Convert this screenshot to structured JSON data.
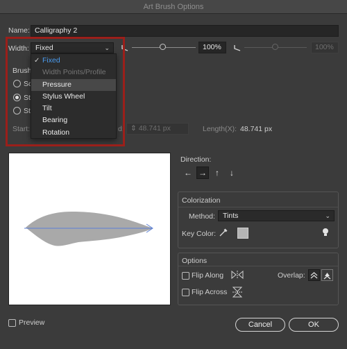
{
  "window": {
    "title": "Art Brush Options"
  },
  "name": {
    "label": "Name:",
    "value": "Calligraphy 2"
  },
  "width": {
    "label": "Width:",
    "selected": "Fixed",
    "percent": "100%",
    "percent_dim": "100%",
    "options": [
      {
        "label": "Fixed",
        "checked": true,
        "disabled": false
      },
      {
        "label": "Width Points/Profile",
        "checked": false,
        "disabled": true
      },
      {
        "label": "Pressure",
        "checked": false,
        "disabled": false,
        "hover": true
      },
      {
        "label": "Stylus Wheel",
        "checked": false,
        "disabled": false
      },
      {
        "label": "Tilt",
        "checked": false,
        "disabled": false
      },
      {
        "label": "Bearing",
        "checked": false,
        "disabled": false
      },
      {
        "label": "Rotation",
        "checked": false,
        "disabled": false
      }
    ]
  },
  "scale": {
    "section_label": "Brush",
    "radio_labels": [
      "Sc",
      "St",
      "St"
    ],
    "start_label": "Start:",
    "end_label": "d:",
    "end_value": "48.741 px",
    "length_label": "Length(X):",
    "length_value": "48.741 px"
  },
  "direction": {
    "label": "Direction:",
    "buttons": [
      "←",
      "→",
      "↑",
      "↓"
    ],
    "selected_index": 1
  },
  "colorization": {
    "label": "Colorization",
    "method_label": "Method:",
    "method_value": "Tints",
    "key_color_label": "Key Color:",
    "key_color_swatch": "#b4b4b4"
  },
  "options": {
    "label": "Options",
    "flip_along": "Flip Along",
    "flip_across": "Flip Across",
    "overlap_label": "Overlap:"
  },
  "preview": {
    "label": "Preview",
    "checked": false
  },
  "buttons": {
    "cancel": "Cancel",
    "ok": "OK"
  },
  "colors": {
    "dialog_bg": "#3b3b3b",
    "accent": "#4a9cf0",
    "highlight": "#9b1f1a",
    "stroke_preview": "#a9a9a9",
    "direction_arrow": "#5a7fd6"
  }
}
